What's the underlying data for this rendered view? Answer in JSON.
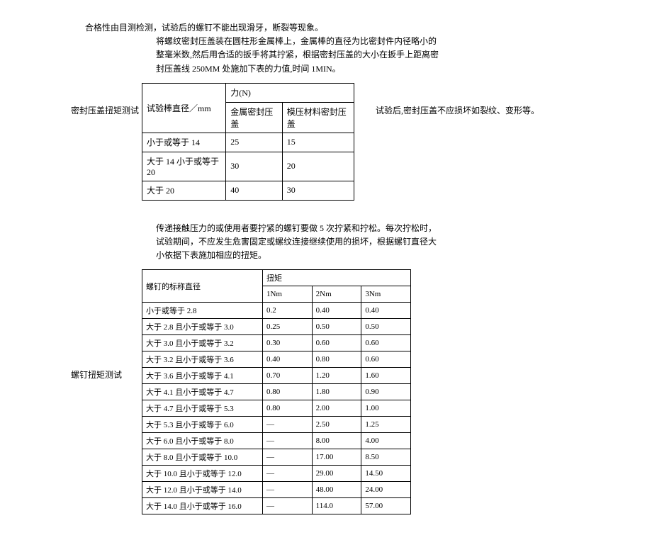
{
  "intro": "合格性由目测检测，试验后的螺钉不能出现滑牙，断裂等现象。",
  "section1": {
    "label": "密封压盖扭矩测试",
    "desc": "将螺纹密封压盖装在圆柱形金属棒上，金属棒的直径为比密封件内径略小的整毫米数,然后用合适的扳手将其拧紧，根据密封压盖的大小在扳手上距离密封压盖线 250MM 处施加下表的力值,时间 1MIN。",
    "afterNote": "试验后,密封压盖不应损坏如裂纹、变形等。",
    "table": {
      "header1": "试验棒直径／mm",
      "header2": "力(N)",
      "subheader1": "金属密封压盖",
      "subheader2": "模压材料密封压盖",
      "rows": [
        {
          "c1": "小于或等于 14",
          "c2": "25",
          "c3": "15"
        },
        {
          "c1": "大于 14 小于或等于20",
          "c2": "30",
          "c3": "20"
        },
        {
          "c1": "大于 20",
          "c2": "40",
          "c3": "30"
        }
      ]
    }
  },
  "section2": {
    "label": "螺钉扭矩测试",
    "desc": "传递接触压力的或使用者要拧紧的螺钉要做 5 次拧紧和拧松。每次拧松时，试验期间，不应发生危害固定或螺纹连接继续使用的损坏，根据螺钉直径大小依据下表施加相应的扭矩。",
    "table": {
      "header1": "螺钉的标称直径",
      "header2": "扭矩",
      "sub1": "1Nm",
      "sub2": "2Nm",
      "sub3": "3Nm",
      "rows": [
        {
          "c1": "小于或等于 2.8",
          "c2": "0.2",
          "c3": "0.40",
          "c4": "0.40"
        },
        {
          "c1": "大于 2.8 且小于或等于 3.0",
          "c2": "0.25",
          "c3": "0.50",
          "c4": "0.50"
        },
        {
          "c1": "大于 3.0 且小于或等于 3.2",
          "c2": "0.30",
          "c3": "0.60",
          "c4": "0.60"
        },
        {
          "c1": "大于 3.2 且小于或等于 3.6",
          "c2": "0.40",
          "c3": "0.80",
          "c4": "0.60"
        },
        {
          "c1": "大于 3.6 且小于或等于 4.1",
          "c2": "0.70",
          "c3": "1.20",
          "c4": "1.60"
        },
        {
          "c1": "大于 4.1 且小于或等于 4.7",
          "c2": "0.80",
          "c3": "1.80",
          "c4": "0.90"
        },
        {
          "c1": "大于 4.7 且小于或等于 5.3",
          "c2": "0.80",
          "c3": "2.00",
          "c4": "1.00"
        },
        {
          "c1": "大于 5.3 且小于或等于 6.0",
          "c2": "—",
          "c3": "2.50",
          "c4": "1.25"
        },
        {
          "c1": "大于 6.0 且小于或等于 8.0",
          "c2": "—",
          "c3": "8.00",
          "c4": "4.00"
        },
        {
          "c1": "大于 8.0 且小于或等于 10.0",
          "c2": "—",
          "c3": "17.00",
          "c4": "8.50"
        },
        {
          "c1": "大于 10.0 且小于或等于 12.0",
          "c2": "—",
          "c3": "29.00",
          "c4": "14.50"
        },
        {
          "c1": "大于 12.0 且小于或等于 14.0",
          "c2": "—",
          "c3": "48.00",
          "c4": "24.00"
        },
        {
          "c1": "大于 14.0 且小于或等于 16.0",
          "c2": "—",
          "c3": "114.0",
          "c4": "57.00"
        }
      ]
    }
  }
}
